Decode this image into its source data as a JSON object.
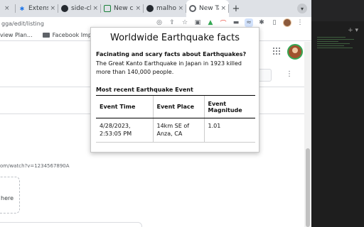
{
  "tabs": [
    {
      "title": "",
      "close": "×"
    },
    {
      "title": "Extensi",
      "close": "×"
    },
    {
      "title": "side-ch",
      "close": "×"
    },
    {
      "title": "New ch",
      "close": "×"
    },
    {
      "title": "malhot",
      "close": "×"
    },
    {
      "title": "New Ta",
      "close": "×"
    }
  ],
  "new_tab_label": "+",
  "address_fragment": "gga/edit/listing",
  "bookmarks": [
    {
      "label": "view Plan..."
    },
    {
      "label": "Facebook Imp..."
    }
  ],
  "page": {
    "url_fragment": "om/watch?v=1234567890A",
    "dropzone_text": "here",
    "kebab": "⋮"
  },
  "popup": {
    "title": "Worldwide Earthquake facts",
    "subtitle": "Facinating and scary facts about Earthquakes?",
    "fact": "The Great Kanto Earthquake in Japan in 1923 killed more than 140,000 people.",
    "recent_heading": "Most recent Earthquake Event",
    "table": {
      "headers": [
        "Event Time",
        "Event Place",
        "Event Magnitude"
      ],
      "rows": [
        [
          "4/28/2023, 2:53:05 PM",
          "14km SE of Anza, CA",
          "1.01"
        ]
      ]
    }
  },
  "sidepanel": {
    "controls": "+ ▾"
  }
}
